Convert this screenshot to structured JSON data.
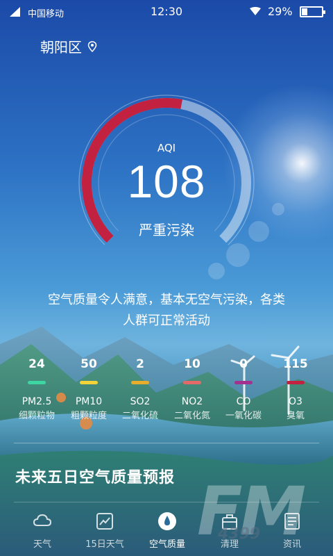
{
  "status_bar": {
    "carrier": "中国移动",
    "time": "12:30",
    "battery_pct": "29%",
    "battery_level": 0.29
  },
  "location": {
    "name": "朝阳区",
    "icon": "location-pin-icon"
  },
  "aqi": {
    "label": "AQI",
    "value": "108",
    "level": "严重污染",
    "gauge_fraction": 0.54,
    "gauge_color": "#c2213f"
  },
  "description": {
    "line1": "空气质量令人满意，基本无空气污染，各类",
    "line2": "人群可正常活动"
  },
  "pollutants": [
    {
      "value": "24",
      "name": "PM2.5",
      "cn": "细颗粒物",
      "color": "#3dd6a2"
    },
    {
      "value": "50",
      "name": "PM10",
      "cn": "粗颗粒度",
      "color": "#f3d23a"
    },
    {
      "value": "2",
      "name": "SO2",
      "cn": "二氧化硫",
      "color": "#e8ad2a"
    },
    {
      "value": "10",
      "name": "NO2",
      "cn": "二氧化氮",
      "color": "#e46a6a"
    },
    {
      "value": "0",
      "name": "CO",
      "cn": "一氧化碳",
      "color": "#a3318e"
    },
    {
      "value": "115",
      "name": "O3",
      "cn": "臭氧",
      "color": "#c2213f"
    }
  ],
  "forecast": {
    "title": "未来五日空气质量预报"
  },
  "nav": [
    {
      "label": "天气",
      "icon": "cloud-icon"
    },
    {
      "label": "15日天气",
      "icon": "chart-line-icon"
    },
    {
      "label": "空气质量",
      "icon": "drop-icon",
      "active": true
    },
    {
      "label": "清理",
      "icon": "briefcase-icon"
    },
    {
      "label": "资讯",
      "icon": "news-icon"
    }
  ],
  "watermark": {
    "text": "FM",
    "number": "4399"
  }
}
